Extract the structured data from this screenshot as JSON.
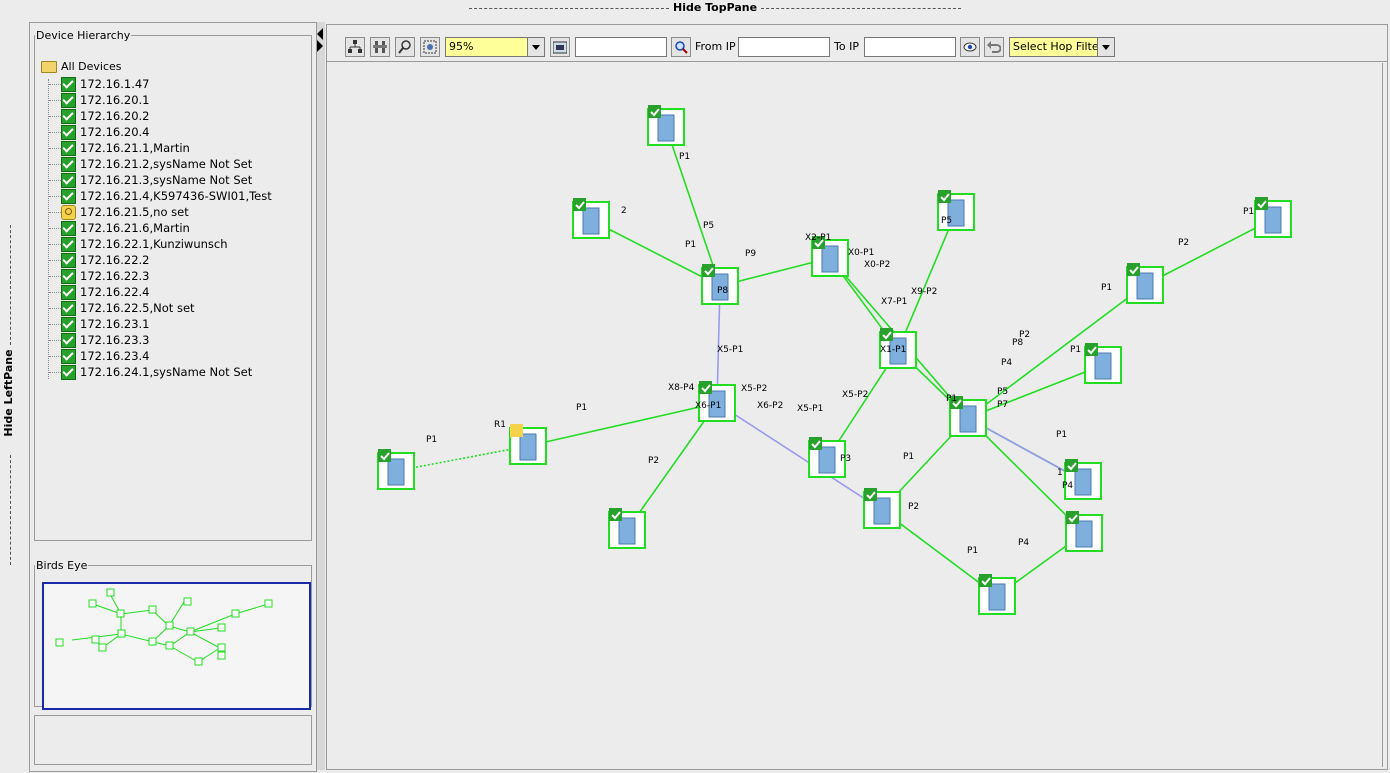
{
  "toppane": {
    "hide_label": "Hide TopPane"
  },
  "leftpane": {
    "hide_label": "Hide LeftPane"
  },
  "device_hierarchy": {
    "legend": "Device Hierarchy",
    "root": "All Devices",
    "items": [
      {
        "label": "172.16.1.47",
        "status": "ok"
      },
      {
        "label": "172.16.20.1",
        "status": "ok"
      },
      {
        "label": "172.16.20.2",
        "status": "ok"
      },
      {
        "label": "172.16.20.4",
        "status": "ok"
      },
      {
        "label": "172.16.21.1,Martin",
        "status": "ok"
      },
      {
        "label": "172.16.21.2,sysName Not Set",
        "status": "ok"
      },
      {
        "label": "172.16.21.3,sysName Not Set",
        "status": "ok"
      },
      {
        "label": "172.16.21.4,K597436-SWI01,Test",
        "status": "ok"
      },
      {
        "label": "172.16.21.5,no set",
        "status": "warning"
      },
      {
        "label": "172.16.21.6,Martin",
        "status": "ok"
      },
      {
        "label": "172.16.22.1,Kunziwunsch",
        "status": "ok"
      },
      {
        "label": "172.16.22.2",
        "status": "ok"
      },
      {
        "label": "172.16.22.3",
        "status": "ok"
      },
      {
        "label": "172.16.22.4",
        "status": "ok"
      },
      {
        "label": "172.16.22.5,Not set",
        "status": "ok"
      },
      {
        "label": "172.16.23.1",
        "status": "ok"
      },
      {
        "label": "172.16.23.3",
        "status": "ok"
      },
      {
        "label": "172.16.23.4",
        "status": "ok"
      },
      {
        "label": "172.16.24.1,sysName Not Set",
        "status": "ok"
      }
    ]
  },
  "birds_eye": {
    "legend": "Birds Eye"
  },
  "toolbar": {
    "zoom_value": "95%",
    "search_value": "",
    "from_ip_label": "From IP",
    "from_ip_value": "",
    "to_ip_label": "To IP",
    "to_ip_value": "",
    "hop_filter_value": "Select Hop Filter"
  },
  "colors": {
    "link": "#22dd22",
    "link_alt": "#9999ee",
    "device_border": "#22dd22",
    "device_fill": "#ffffff",
    "device_icon": "#7fb0dd",
    "check": "#27a12b",
    "warning": "#f4d34a",
    "birds_eye_frame": "#1a2aa8"
  },
  "topology": {
    "node_labels": [
      "P1",
      "2",
      "P5",
      "P1",
      "P9",
      "X2-P1",
      "X0-P1",
      "X0-P2",
      "P8",
      "X7-P1",
      "X9-P2",
      "P5",
      "P1",
      "P2",
      "P1",
      "P2",
      "P8",
      "P4",
      "P1",
      "X1-P1",
      "X5-P1",
      "X8-P4",
      "X5-P2",
      "X6-P1",
      "X6-P2",
      "X5-P1",
      "X5-P2",
      "P1",
      "R1",
      "P1",
      "P2",
      "P3",
      "P1",
      "P1",
      "P5",
      "P7",
      "P1",
      "1",
      "P4",
      "P2",
      "P1",
      "P4"
    ]
  }
}
